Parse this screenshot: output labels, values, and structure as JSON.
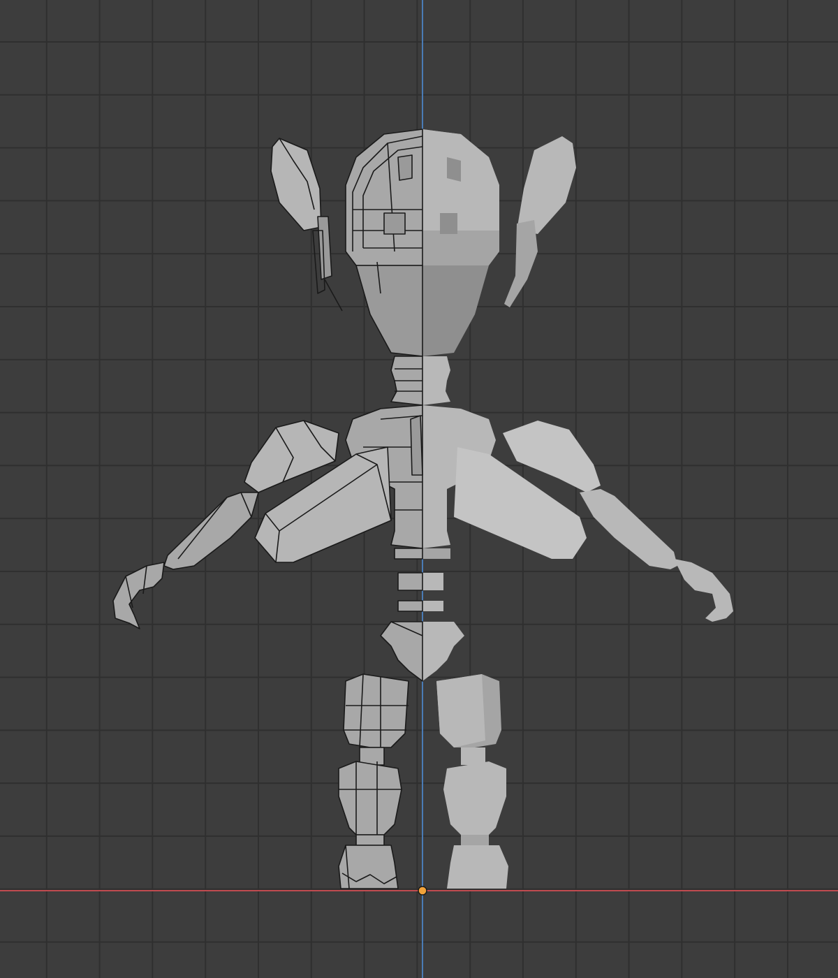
{
  "viewport": {
    "colors": {
      "background": "#3d3d3d",
      "grid_line": "#2f2f2f",
      "x_axis": "#c04b50",
      "z_axis": "#4a7bb5",
      "origin": "#f2a33a",
      "wireframe_edge": "#1a1a1a",
      "mesh_light": "#c4c4c4",
      "mesh_mid": "#a5a5a5",
      "mesh_dark": "#8f8f8f"
    },
    "view": "front-orthographic",
    "shading_left": "wireframe",
    "shading_right": "solid"
  }
}
